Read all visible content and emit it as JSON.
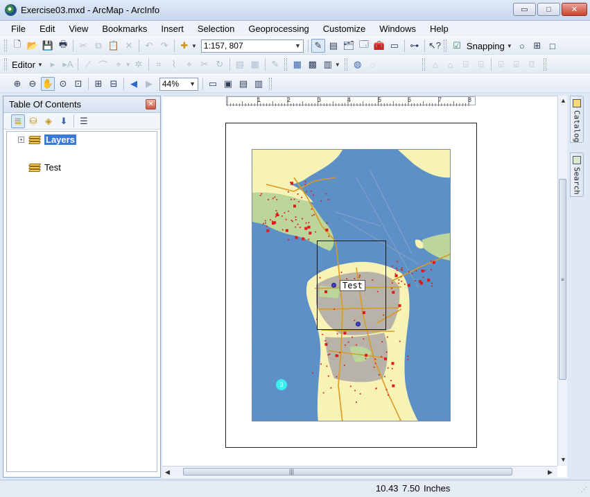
{
  "window": {
    "title": "Exercise03.mxd - ArcMap - ArcInfo",
    "minimize_symbol": "▭",
    "maximize_symbol": "□",
    "close_symbol": "✕"
  },
  "menu": [
    "File",
    "Edit",
    "View",
    "Bookmarks",
    "Insert",
    "Selection",
    "Geoprocessing",
    "Customize",
    "Windows",
    "Help"
  ],
  "standard_toolbar": {
    "scale_value": "1:157, 807",
    "snapping_label": "Snapping"
  },
  "editor_toolbar": {
    "editor_label": "Editor"
  },
  "layout_toolbar": {
    "zoom_percent": "44%"
  },
  "toc": {
    "title": "Table Of Contents",
    "items": [
      {
        "label": "Layers",
        "selected": true,
        "expander": "+"
      },
      {
        "label": "Test",
        "selected": false
      }
    ]
  },
  "ruler": {
    "ticks": [
      "1",
      "2",
      "3",
      "4",
      "5",
      "6",
      "7",
      "8"
    ]
  },
  "map": {
    "label_text": "Test",
    "marker_number": "3",
    "colors": {
      "water": "#5e90c8",
      "land": "#f7f3b5",
      "park": "#bcd59a",
      "urban": "#b8b3a8",
      "roads": "#d99a24",
      "points": "#e01818"
    }
  },
  "dock_tabs": {
    "catalog": "Catalog",
    "search": "Search"
  },
  "status": {
    "coords": "10.43  7.50 Inches"
  }
}
